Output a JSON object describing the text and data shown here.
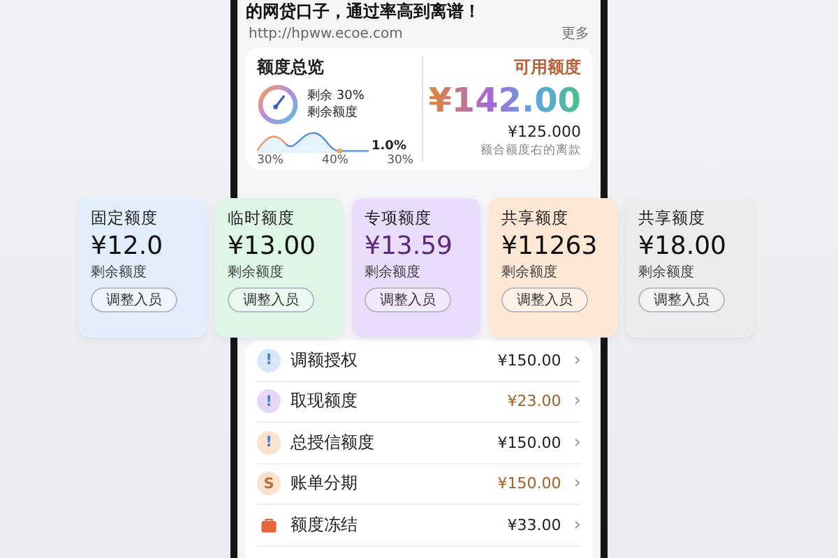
{
  "headline": "的网贷口子，通过率高到离谱！",
  "url": "http://hpww.ecoe.com",
  "more": "更多",
  "overview": {
    "title": "额度总览",
    "remain_pct": "剩余 30%",
    "remain_label": "剩余额度",
    "wave_value": "1.0%",
    "wave_labels": [
      "30%",
      "40%",
      "30%"
    ],
    "available_label": "可用额度",
    "available": "¥142.00",
    "total": "¥125.000",
    "note": "额合额度右的离款"
  },
  "cards": [
    {
      "title": "固定额度",
      "amount": "¥12.0",
      "label": "剩余额度",
      "button": "调整入员",
      "color": "#e3eefc"
    },
    {
      "title": "临时额度",
      "amount": "¥13.00",
      "label": "剩余额度",
      "button": "调整入员",
      "color": "#dff5e6"
    },
    {
      "title": "专项额度",
      "amount": "¥13.59",
      "label": "剩余额度",
      "button": "调整入员",
      "color": "#eadcfb"
    },
    {
      "title": "共享额度",
      "amount": "¥11263",
      "label": "剩余额度",
      "button": "调整入员",
      "color": "#fde8d6"
    },
    {
      "title": "共享额度",
      "amount": "¥18.00",
      "label": "剩余额度",
      "button": "调整入员",
      "color": "#ececee"
    }
  ],
  "items": [
    {
      "kind": "glyph",
      "glyph": "!",
      "color": "#d6e8fa",
      "label": "调额授权",
      "amount": "¥150.00",
      "highlight": false,
      "chevron": "›"
    },
    {
      "kind": "glyph",
      "glyph": "!",
      "color": "#e6d6f7",
      "label": "取现额度",
      "amount": "¥23.00",
      "highlight": true,
      "chevron": "›"
    },
    {
      "kind": "glyph",
      "glyph": "!",
      "color": "#fbe2cf",
      "label": "总授信额度",
      "amount": "¥150.00",
      "highlight": false,
      "chevron": "›"
    },
    {
      "kind": "glyph",
      "glyph": "S",
      "color": "#fbe2cf",
      "label": "账单分期",
      "amount": "¥150.00",
      "highlight": true,
      "chevron": "›"
    },
    {
      "kind": "bag",
      "color": "#e8643a",
      "label": "额度冻结",
      "amount": "¥33.00",
      "highlight": false,
      "chevron": "›"
    }
  ]
}
